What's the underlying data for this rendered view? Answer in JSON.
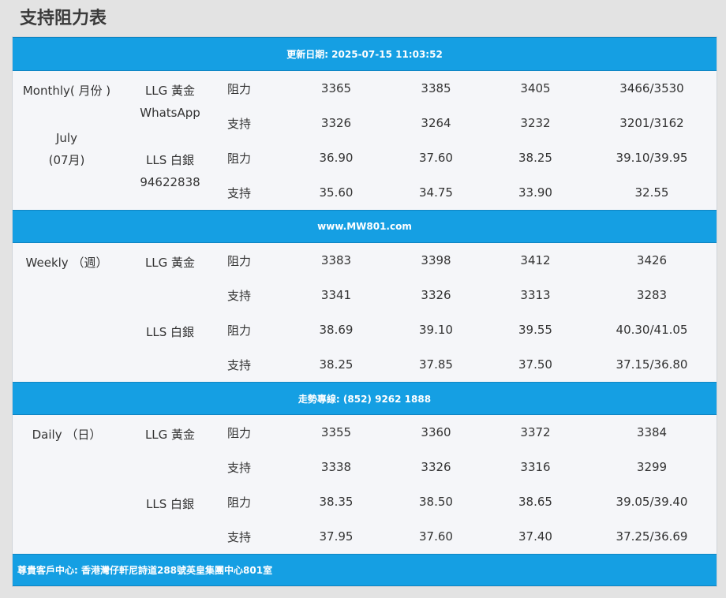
{
  "page_title": "支持阻力表",
  "header_bar": "更新日期: 2025-07-15 11:03:52",
  "mid_bar_1": "www.MW801.com",
  "mid_bar_2": "走勢專線: (852) 9262 1888",
  "footer_bar": "尊貴客戶中心: 香港灣仔軒尼詩道288號英皇集團中心801室",
  "sections": [
    {
      "period_lines": [
        "Monthly( 月份 )",
        "",
        "July",
        "(07月)"
      ],
      "metals": [
        {
          "name_lines": [
            "LLG 黃金",
            "WhatsApp"
          ],
          "rows": [
            {
              "type": "阻力",
              "values": [
                "3365",
                "3385",
                "3405",
                "3466/3530"
              ]
            },
            {
              "type": "支持",
              "values": [
                "3326",
                "3264",
                "3232",
                "3201/3162"
              ]
            }
          ]
        },
        {
          "name_lines": [
            "LLS 白銀",
            "94622838"
          ],
          "rows": [
            {
              "type": "阻力",
              "values": [
                "36.90",
                "37.60",
                "38.25",
                "39.10/39.95"
              ]
            },
            {
              "type": "支持",
              "values": [
                "35.60",
                "34.75",
                "33.90",
                "32.55"
              ]
            }
          ]
        }
      ]
    },
    {
      "period_lines": [
        "Weekly （週）"
      ],
      "metals": [
        {
          "name_lines": [
            "LLG 黃金"
          ],
          "rows": [
            {
              "type": "阻力",
              "values": [
                "3383",
                "3398",
                "3412",
                "3426"
              ]
            },
            {
              "type": "支持",
              "values": [
                "3341",
                "3326",
                "3313",
                "3283"
              ]
            }
          ]
        },
        {
          "name_lines": [
            "LLS 白銀"
          ],
          "rows": [
            {
              "type": "阻力",
              "values": [
                "38.69",
                "39.10",
                "39.55",
                "40.30/41.05"
              ]
            },
            {
              "type": "支持",
              "values": [
                "38.25",
                "37.85",
                "37.50",
                "37.15/36.80"
              ]
            }
          ]
        }
      ]
    },
    {
      "period_lines": [
        "Daily （日）"
      ],
      "metals": [
        {
          "name_lines": [
            "LLG 黃金"
          ],
          "rows": [
            {
              "type": "阻力",
              "values": [
                "3355",
                "3360",
                "3372",
                "3384"
              ]
            },
            {
              "type": "支持",
              "values": [
                "3338",
                "3326",
                "3316",
                "3299"
              ]
            }
          ]
        },
        {
          "name_lines": [
            "LLS 白銀"
          ],
          "rows": [
            {
              "type": "阻力",
              "values": [
                "38.35",
                "38.50",
                "38.65",
                "39.05/39.40"
              ]
            },
            {
              "type": "支持",
              "values": [
                "37.95",
                "37.60",
                "37.40",
                "37.25/36.69"
              ]
            }
          ]
        }
      ]
    }
  ]
}
